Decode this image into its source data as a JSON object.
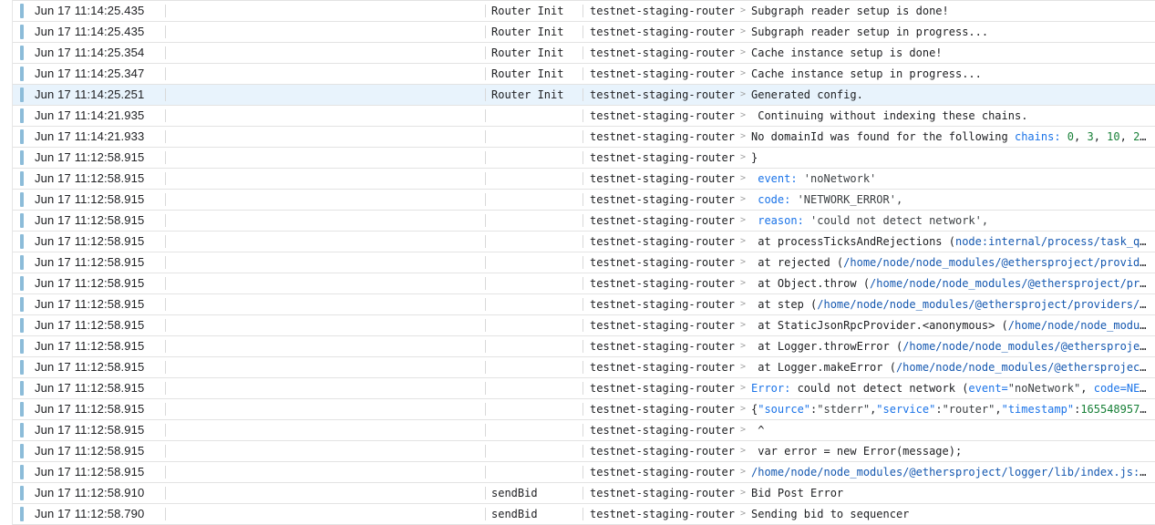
{
  "rows": [
    {
      "time": "Jun 17 11:14:25.435",
      "context": "Router Init",
      "service": "testnet-staging-router",
      "message": [
        {
          "t": "Subgraph reader setup is done!",
          "k": "plain"
        }
      ]
    },
    {
      "time": "Jun 17 11:14:25.435",
      "context": "Router Init",
      "service": "testnet-staging-router",
      "message": [
        {
          "t": "Subgraph reader setup in progress...",
          "k": "plain"
        }
      ]
    },
    {
      "time": "Jun 17 11:14:25.354",
      "context": "Router Init",
      "service": "testnet-staging-router",
      "message": [
        {
          "t": "Cache instance setup is done!",
          "k": "plain"
        }
      ]
    },
    {
      "time": "Jun 17 11:14:25.347",
      "context": "Router Init",
      "service": "testnet-staging-router",
      "message": [
        {
          "t": "Cache instance setup in progress...",
          "k": "plain"
        }
      ]
    },
    {
      "time": "Jun 17 11:14:25.251",
      "context": "Router Init",
      "service": "testnet-staging-router",
      "selected": true,
      "message": [
        {
          "t": "Generated config.",
          "k": "plain"
        }
      ]
    },
    {
      "time": "Jun 17 11:14:21.935",
      "context": "",
      "service": "testnet-staging-router",
      "message": [
        {
          "t": " Continuing without indexing these chains.",
          "k": "plain"
        }
      ]
    },
    {
      "time": "Jun 17 11:14:21.933",
      "context": "",
      "service": "testnet-staging-router",
      "message": [
        {
          "t": "No domainId was found for the following ",
          "k": "plain"
        },
        {
          "t": "chains: ",
          "k": "key"
        },
        {
          "t": "0",
          "k": "num"
        },
        {
          "t": ", ",
          "k": "plain"
        },
        {
          "t": "3",
          "k": "num"
        },
        {
          "t": ", ",
          "k": "plain"
        },
        {
          "t": "10",
          "k": "num"
        },
        {
          "t": ", ",
          "k": "plain"
        },
        {
          "t": "25…",
          "k": "num"
        }
      ]
    },
    {
      "time": "Jun 17 11:12:58.915",
      "context": "",
      "service": "testnet-staging-router",
      "message": [
        {
          "t": "}",
          "k": "plain"
        }
      ]
    },
    {
      "time": "Jun 17 11:12:58.915",
      "context": "",
      "service": "testnet-staging-router",
      "message": [
        {
          "t": " event: ",
          "k": "key"
        },
        {
          "t": "'noNetwork'",
          "k": "str"
        }
      ]
    },
    {
      "time": "Jun 17 11:12:58.915",
      "context": "",
      "service": "testnet-staging-router",
      "message": [
        {
          "t": " code: ",
          "k": "key"
        },
        {
          "t": "'NETWORK_ERROR',",
          "k": "str"
        }
      ]
    },
    {
      "time": "Jun 17 11:12:58.915",
      "context": "",
      "service": "testnet-staging-router",
      "message": [
        {
          "t": " reason: ",
          "k": "key"
        },
        {
          "t": "'could not detect network',",
          "k": "str"
        }
      ]
    },
    {
      "time": "Jun 17 11:12:58.915",
      "context": "",
      "service": "testnet-staging-router",
      "message": [
        {
          "t": " at processTicksAndRejections (",
          "k": "plain"
        },
        {
          "t": "node:internal/process/task_qu…",
          "k": "link"
        }
      ]
    },
    {
      "time": "Jun 17 11:12:58.915",
      "context": "",
      "service": "testnet-staging-router",
      "message": [
        {
          "t": " at rejected (",
          "k": "plain"
        },
        {
          "t": "/home/node/node_modules/@ethersproject/provide…",
          "k": "link"
        }
      ]
    },
    {
      "time": "Jun 17 11:12:58.915",
      "context": "",
      "service": "testnet-staging-router",
      "message": [
        {
          "t": " at Object.throw (",
          "k": "plain"
        },
        {
          "t": "/home/node/node_modules/@ethersproject/pro…",
          "k": "link"
        }
      ]
    },
    {
      "time": "Jun 17 11:12:58.915",
      "context": "",
      "service": "testnet-staging-router",
      "message": [
        {
          "t": " at step (",
          "k": "plain"
        },
        {
          "t": "/home/node/node_modules/@ethersproject/providers/l…",
          "k": "link"
        }
      ]
    },
    {
      "time": "Jun 17 11:12:58.915",
      "context": "",
      "service": "testnet-staging-router",
      "message": [
        {
          "t": " at StaticJsonRpcProvider.<anonymous> (",
          "k": "plain"
        },
        {
          "t": "/home/node/node_modul…",
          "k": "link"
        }
      ]
    },
    {
      "time": "Jun 17 11:12:58.915",
      "context": "",
      "service": "testnet-staging-router",
      "message": [
        {
          "t": " at Logger.throwError (",
          "k": "plain"
        },
        {
          "t": "/home/node/node_modules/@ethersprojec…",
          "k": "link"
        }
      ]
    },
    {
      "time": "Jun 17 11:12:58.915",
      "context": "",
      "service": "testnet-staging-router",
      "message": [
        {
          "t": " at Logger.makeError (",
          "k": "plain"
        },
        {
          "t": "/home/node/node_modules/@ethersproject…",
          "k": "link"
        }
      ]
    },
    {
      "time": "Jun 17 11:12:58.915",
      "context": "",
      "service": "testnet-staging-router",
      "message": [
        {
          "t": "Error: ",
          "k": "key"
        },
        {
          "t": "could not detect network (",
          "k": "plain"
        },
        {
          "t": "event=",
          "k": "key"
        },
        {
          "t": "\"noNetwork\"",
          "k": "str"
        },
        {
          "t": ", ",
          "k": "plain"
        },
        {
          "t": "code=NET…",
          "k": "key"
        }
      ]
    },
    {
      "time": "Jun 17 11:12:58.915",
      "context": "",
      "service": "testnet-staging-router",
      "message": [
        {
          "t": "{",
          "k": "plain"
        },
        {
          "t": "\"source\"",
          "k": "key"
        },
        {
          "t": ":",
          "k": "plain"
        },
        {
          "t": "\"stderr\"",
          "k": "str"
        },
        {
          "t": ",",
          "k": "plain"
        },
        {
          "t": "\"service\"",
          "k": "key"
        },
        {
          "t": ":",
          "k": "plain"
        },
        {
          "t": "\"router\"",
          "k": "str"
        },
        {
          "t": ",",
          "k": "plain"
        },
        {
          "t": "\"timestamp\"",
          "k": "key"
        },
        {
          "t": ":",
          "k": "plain"
        },
        {
          "t": "1655489578…",
          "k": "num"
        }
      ]
    },
    {
      "time": "Jun 17 11:12:58.915",
      "context": "",
      "service": "testnet-staging-router",
      "message": [
        {
          "t": " ^",
          "k": "plain"
        }
      ]
    },
    {
      "time": "Jun 17 11:12:58.915",
      "context": "",
      "service": "testnet-staging-router",
      "message": [
        {
          "t": " var error = new Error(message);",
          "k": "plain"
        }
      ]
    },
    {
      "time": "Jun 17 11:12:58.915",
      "context": "",
      "service": "testnet-staging-router",
      "message": [
        {
          "t": "/home/node/node_modules/@ethersproject/logger/lib/index.js:2…",
          "k": "link"
        }
      ]
    },
    {
      "time": "Jun 17 11:12:58.910",
      "context": "sendBid",
      "service": "testnet-staging-router",
      "message": [
        {
          "t": "Bid Post Error",
          "k": "plain"
        }
      ]
    },
    {
      "time": "Jun 17 11:12:58.790",
      "context": "sendBid",
      "service": "testnet-staging-router",
      "message": [
        {
          "t": "Sending bid to sequencer",
          "k": "plain"
        }
      ]
    }
  ],
  "chevron_glyph": ">",
  "colors": {
    "severity": "#8cbcd9",
    "selected_row": "#e8f3fc",
    "key": "#1a73e8",
    "number": "#188038",
    "link": "#1558b0"
  }
}
